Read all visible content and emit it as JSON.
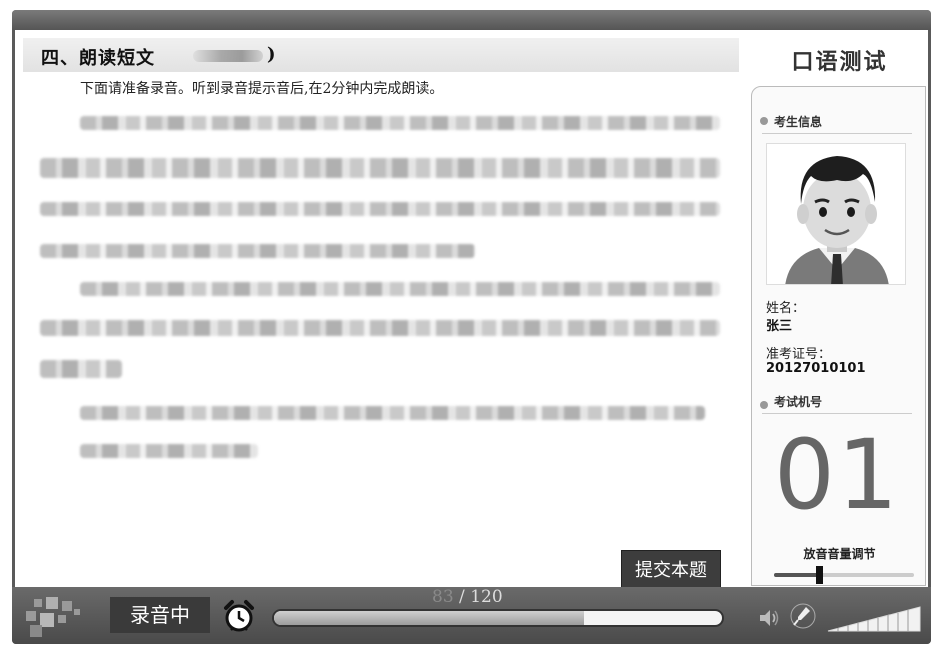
{
  "section": {
    "title": "四、朗读短文",
    "close_paren": ")",
    "instruction": "下面请准备录音。听到录音提示音后,在2分钟内完成朗读。"
  },
  "submit_label": "提交本题",
  "sidebar": {
    "app_title": "口语测试",
    "candidate_info_label": "考生信息",
    "name_label": "姓名：",
    "name_value": "张三",
    "id_label": "准考证号：",
    "id_value": "20127010101",
    "machine_label": "考试机号",
    "machine_number": "01",
    "volume_label": "放音音量调节",
    "volume_level": 0.32
  },
  "bottombar": {
    "recording_status": "录音中",
    "progress_current": "83",
    "progress_separator": "/",
    "progress_total": "120",
    "progress_fraction": 0.6917
  },
  "icons": [
    "alarm-clock-icon",
    "speaker-icon",
    "microphone-icon",
    "signal-level-icon",
    "app-logo"
  ],
  "colors": {
    "frame": "#5a5a5a",
    "button": "#3d3d3d",
    "machine_number": "#666666"
  }
}
